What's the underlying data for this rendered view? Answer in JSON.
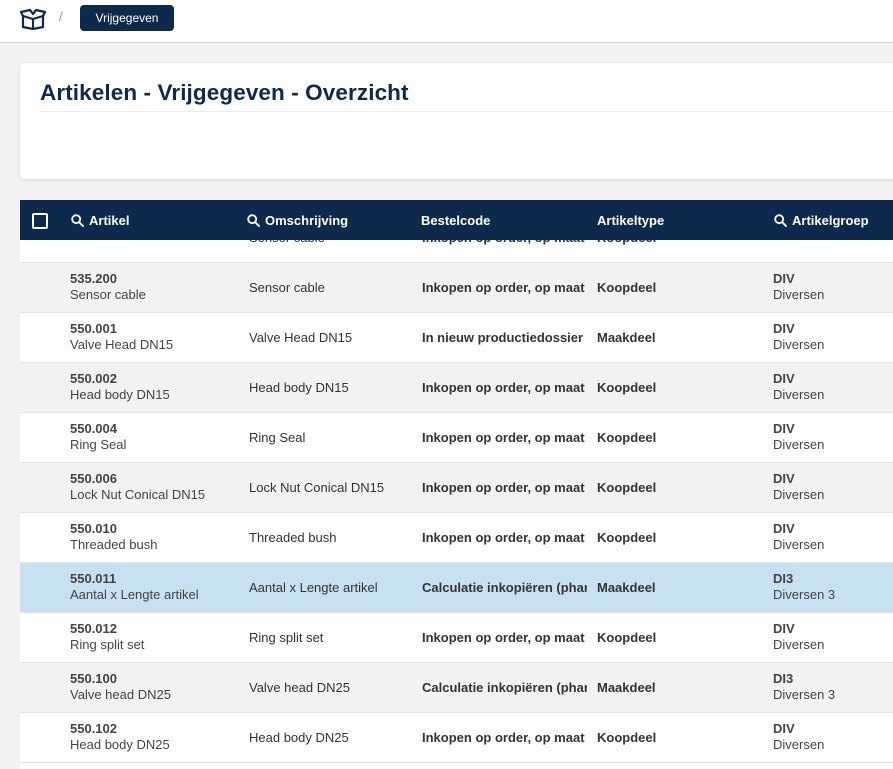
{
  "breadcrumb": {
    "separator": "/",
    "current": "Vrijgegeven"
  },
  "page": {
    "title": "Artikelen - Vrijgegeven - Overzicht"
  },
  "table": {
    "headers": {
      "artikel": "Artikel",
      "omschrijving": "Omschrijving",
      "bestelcode": "Bestelcode",
      "artikeltype": "Artikeltype",
      "artikelgroep": "Artikelgroep"
    },
    "rows": [
      {
        "code": "",
        "name": "Sensor cable",
        "description": "Sensor cable",
        "bestelcode": "Inkopen op order, op maat",
        "type": "Koopdeel",
        "group_code": "",
        "group_name": "Diversen",
        "selected": false
      },
      {
        "code": "535.200",
        "name": "Sensor cable",
        "description": "Sensor cable",
        "bestelcode": "Inkopen op order, op maat",
        "type": "Koopdeel",
        "group_code": "DIV",
        "group_name": "Diversen",
        "selected": false
      },
      {
        "code": "550.001",
        "name": "Valve Head DN15",
        "description": "Valve Head DN15",
        "bestelcode": "In nieuw productiedossier pr",
        "type": "Maakdeel",
        "group_code": "DIV",
        "group_name": "Diversen",
        "selected": false
      },
      {
        "code": "550.002",
        "name": "Head body DN15",
        "description": "Head body DN15",
        "bestelcode": "Inkopen op order, op maat",
        "type": "Koopdeel",
        "group_code": "DIV",
        "group_name": "Diversen",
        "selected": false
      },
      {
        "code": "550.004",
        "name": "Ring Seal",
        "description": "Ring Seal",
        "bestelcode": "Inkopen op order, op maat",
        "type": "Koopdeel",
        "group_code": "DIV",
        "group_name": "Diversen",
        "selected": false
      },
      {
        "code": "550.006",
        "name": "Lock Nut Conical DN15",
        "description": "Lock Nut Conical DN15",
        "bestelcode": "Inkopen op order, op maat",
        "type": "Koopdeel",
        "group_code": "DIV",
        "group_name": "Diversen",
        "selected": false
      },
      {
        "code": "550.010",
        "name": "Threaded bush",
        "description": "Threaded bush",
        "bestelcode": "Inkopen op order, op maat",
        "type": "Koopdeel",
        "group_code": "DIV",
        "group_name": "Diversen",
        "selected": false
      },
      {
        "code": "550.011",
        "name": "Aantal x Lengte artikel",
        "description": "Aantal x Lengte artikel",
        "bestelcode": "Calculatie inkopiëren (phanto",
        "type": "Maakdeel",
        "group_code": "DI3",
        "group_name": "Diversen 3",
        "selected": true
      },
      {
        "code": "550.012",
        "name": "Ring split set",
        "description": "Ring split set",
        "bestelcode": "Inkopen op order, op maat",
        "type": "Koopdeel",
        "group_code": "DIV",
        "group_name": "Diversen",
        "selected": false
      },
      {
        "code": "550.100",
        "name": "Valve head DN25",
        "description": "Valve head DN25",
        "bestelcode": "Calculatie inkopiëren (phanto",
        "type": "Maakdeel",
        "group_code": "DI3",
        "group_name": "Diversen 3",
        "selected": false
      },
      {
        "code": "550.102",
        "name": "Head body DN25",
        "description": "Head body DN25",
        "bestelcode": "Inkopen op order, op maat",
        "type": "Koopdeel",
        "group_code": "DIV",
        "group_name": "Diversen",
        "selected": false
      }
    ]
  },
  "colors": {
    "navy": "#0d2a4c",
    "selected_row": "#c7e1f3",
    "stripe_row": "#f2f2f2"
  },
  "icons": {
    "home": "open-box-icon",
    "search": "search-icon",
    "checkbox": "checkbox-icon"
  }
}
